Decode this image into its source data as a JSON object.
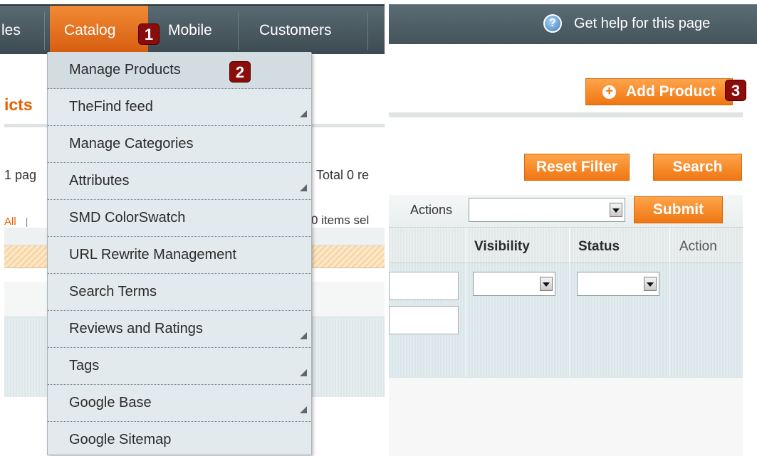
{
  "nav": {
    "partial_left": "les",
    "catalog": "Catalog",
    "mobile": "Mobile",
    "customers": "Customers"
  },
  "badges": {
    "one": "1",
    "two": "2",
    "three": "3"
  },
  "page_title_partial": "icts",
  "pager": {
    "pages_partial": "1 pag",
    "total_partial": "Total 0 re",
    "select_all_partial": "All",
    "separator": "|",
    "items_selected_partial": "0 items sel"
  },
  "catalog_menu": {
    "items": [
      {
        "label": "Manage Products",
        "has_submenu": false
      },
      {
        "label": "TheFind feed",
        "has_submenu": true
      },
      {
        "label": "Manage Categories",
        "has_submenu": false
      },
      {
        "label": "Attributes",
        "has_submenu": true
      },
      {
        "label": "SMD ColorSwatch",
        "has_submenu": false
      },
      {
        "label": "URL Rewrite Management",
        "has_submenu": false
      },
      {
        "label": "Search Terms",
        "has_submenu": false
      },
      {
        "label": "Reviews and Ratings",
        "has_submenu": true
      },
      {
        "label": "Tags",
        "has_submenu": true
      },
      {
        "label": "Google Base",
        "has_submenu": true
      },
      {
        "label": "Google Sitemap",
        "has_submenu": false
      }
    ]
  },
  "help": {
    "icon": "help-icon",
    "text": "Get help for this page"
  },
  "buttons": {
    "add_product": "Add Product",
    "reset_filter": "Reset Filter",
    "search": "Search",
    "submit": "Submit"
  },
  "massaction": {
    "label": "Actions",
    "selected": ""
  },
  "grid": {
    "columns": [
      "Visibility",
      "Status",
      "Action"
    ]
  },
  "colors": {
    "accent_orange": "#f07612",
    "title_orange": "#eb5e00",
    "nav_bg": "#4a5960",
    "badge_red": "#8c0c0c"
  }
}
